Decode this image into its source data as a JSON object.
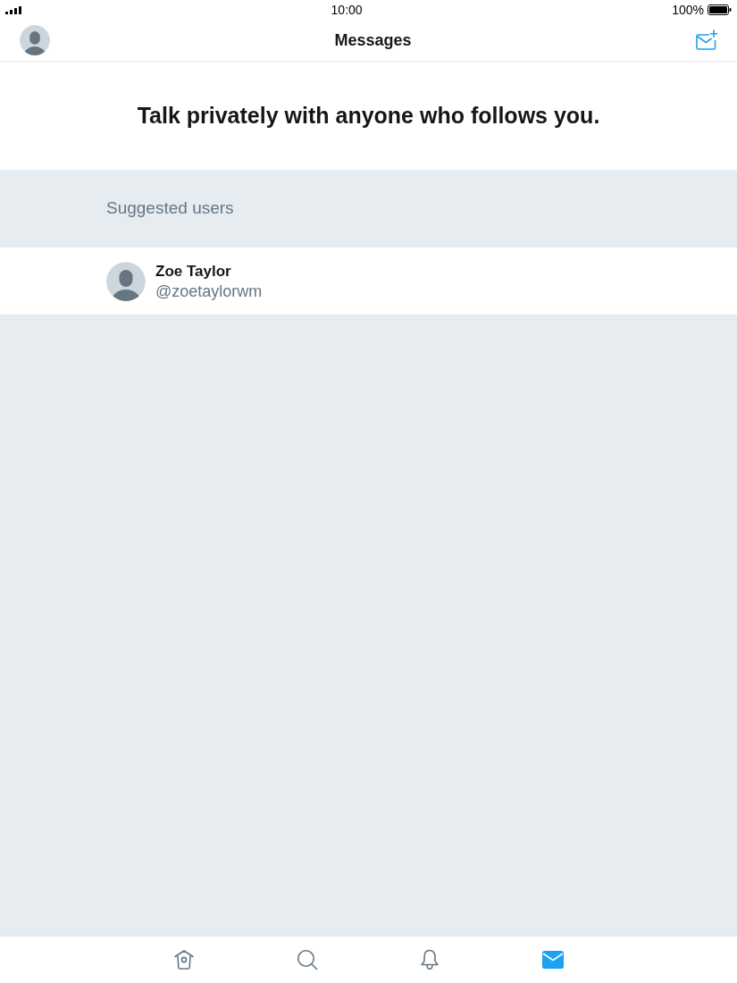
{
  "status_bar": {
    "time": "10:00",
    "battery": "100%"
  },
  "nav_bar": {
    "title": "Messages"
  },
  "empty_state": {
    "heading": "Talk privately with anyone who follows you."
  },
  "suggested_users": {
    "header": "Suggested users",
    "users": [
      {
        "name": "Zoe Taylor",
        "handle": "@zoetaylorwm"
      }
    ]
  },
  "tab_bar": {
    "tabs": [
      {
        "kind": "home",
        "selected": false
      },
      {
        "kind": "search",
        "selected": false
      },
      {
        "kind": "notifications",
        "selected": false
      },
      {
        "kind": "messages",
        "selected": true
      }
    ]
  }
}
